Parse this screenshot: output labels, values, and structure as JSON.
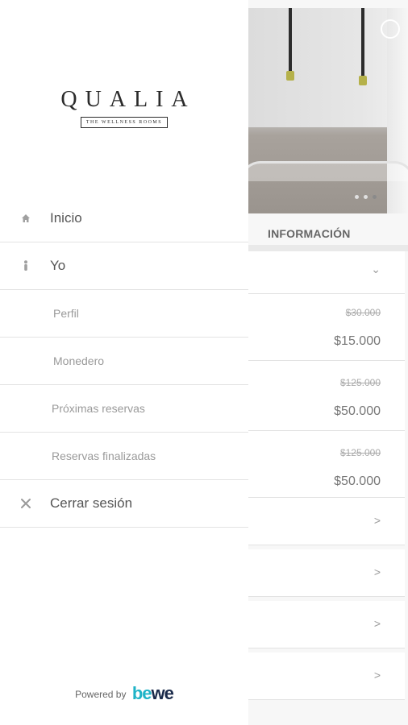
{
  "drawer": {
    "logo": {
      "wordmark": "QUALIA",
      "tagline": "THE WELLNESS ROOMS"
    },
    "menu": [
      {
        "label": "Inicio",
        "icon": "home-icon"
      },
      {
        "label": "Yo",
        "icon": "person-icon"
      },
      {
        "label": "Perfil"
      },
      {
        "label": "Monedero"
      },
      {
        "label": "Próximas reservas"
      },
      {
        "label": "Reservas finalizadas"
      },
      {
        "label": "Cerrar sesión",
        "icon": "close-icon"
      }
    ],
    "footer": {
      "prefix": "Powered by",
      "brand_a": "be",
      "brand_b": "we"
    }
  },
  "background": {
    "section_label": "INFORMACIÓN",
    "chevron_down": "⌄",
    "chevron_right": ">",
    "prices": [
      {
        "old": "$30.000",
        "new": "$15.000"
      },
      {
        "old": "$125.000",
        "new": "$50.000"
      },
      {
        "old": "$125.000",
        "new": "$50.000"
      }
    ]
  },
  "colors": {
    "accent": "#1fb3c7",
    "brand_dark": "#1a2a4a",
    "divider": "#e3e3e3"
  }
}
